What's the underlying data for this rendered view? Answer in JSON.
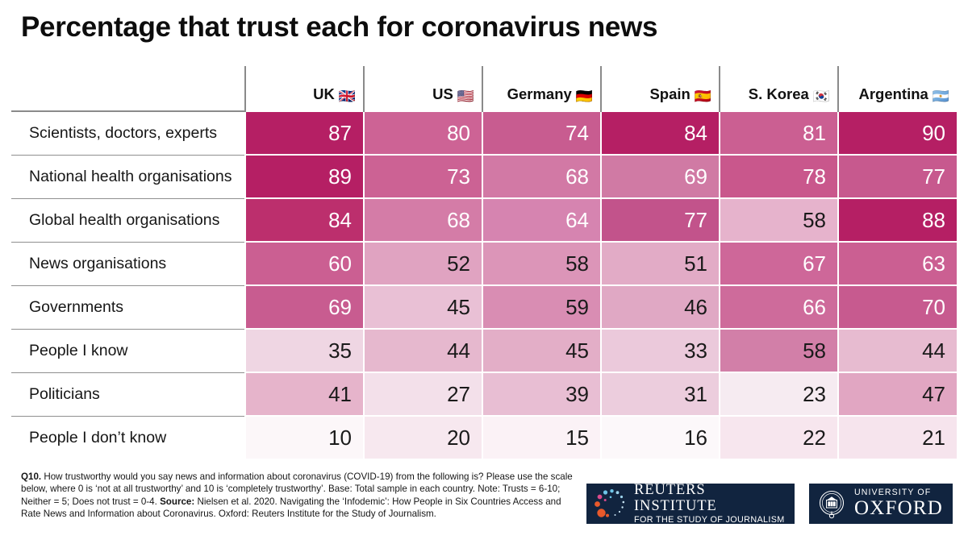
{
  "title": "Percentage that trust each for coronavirus news",
  "table": {
    "corner_label": "",
    "columns": [
      {
        "name": "UK",
        "flag": "🇬🇧"
      },
      {
        "name": "US",
        "flag": "🇺🇸"
      },
      {
        "name": "Germany",
        "flag": "🇩🇪"
      },
      {
        "name": "Spain",
        "flag": "🇪🇸"
      },
      {
        "name": "S. Korea",
        "flag": "🇰🇷"
      },
      {
        "name": "Argentina",
        "flag": "🇦🇷"
      }
    ],
    "rows": [
      {
        "label": "Scientists, doctors, experts"
      },
      {
        "label": "National health organisations"
      },
      {
        "label": "Global health organisations"
      },
      {
        "label": "News organisations"
      },
      {
        "label": "Governments"
      },
      {
        "label": "People I know"
      },
      {
        "label": "Politicians"
      },
      {
        "label": "People I don’t know"
      }
    ]
  },
  "chart_data": {
    "type": "heatmap",
    "title": "Percentage that trust each for coronavirus news",
    "xlabel": "",
    "ylabel": "",
    "unit": "percent",
    "grid": false,
    "legend": "none",
    "colorscale": {
      "low": "#FBF2F6",
      "high": "#B51F64",
      "normalisation": "per-column"
    },
    "value_range": [
      10,
      90
    ],
    "categories": [
      "UK",
      "US",
      "Germany",
      "Spain",
      "S. Korea",
      "Argentina"
    ],
    "rows": [
      "Scientists, doctors, experts",
      "National health organisations",
      "Global health organisations",
      "News organisations",
      "Governments",
      "People I know",
      "Politicians",
      "People I don’t know"
    ],
    "values": [
      [
        87,
        80,
        74,
        84,
        81,
        90
      ],
      [
        89,
        73,
        68,
        69,
        78,
        77
      ],
      [
        84,
        68,
        64,
        77,
        58,
        88
      ],
      [
        60,
        52,
        58,
        51,
        67,
        63
      ],
      [
        69,
        45,
        59,
        46,
        66,
        70
      ],
      [
        35,
        44,
        45,
        33,
        58,
        44
      ],
      [
        41,
        27,
        39,
        31,
        23,
        47
      ],
      [
        10,
        20,
        15,
        16,
        22,
        21
      ]
    ],
    "cell_colors": [
      [
        "#B51F64",
        "#CD6395",
        "#C85C90",
        "#B51F64",
        "#CB5F92",
        "#B51F64"
      ],
      [
        "#B51F64",
        "#CC6294",
        "#D279A5",
        "#D07AA4",
        "#C9578C",
        "#C7598E"
      ],
      [
        "#BC2F6D",
        "#D47CA7",
        "#D684B0",
        "#C2538B",
        "#E6B3CC",
        "#B51F64"
      ],
      [
        "#CB5F92",
        "#E0A3C1",
        "#DC95B8",
        "#E2ABC6",
        "#CE6799",
        "#CB5F92"
      ],
      [
        "#C85C90",
        "#E9C0D5",
        "#D98DB3",
        "#E0A8C4",
        "#CE6B9B",
        "#C75A8F"
      ],
      [
        "#EFD6E3",
        "#E6B8CE",
        "#E3AEC7",
        "#EBC9DB",
        "#D27FA8",
        "#E7BBD0"
      ],
      [
        "#E6B4CB",
        "#F3E0EA",
        "#E8BED3",
        "#ECCDDD",
        "#F6EBF1",
        "#E1A6C2"
      ],
      [
        "#FCF7F9",
        "#F7E8EF",
        "#FBF2F6",
        "#FCF8FA",
        "#F7E6EE",
        "#F6E4ED"
      ]
    ],
    "text_colors": [
      [
        "#ffffff",
        "#ffffff",
        "#ffffff",
        "#ffffff",
        "#ffffff",
        "#ffffff"
      ],
      [
        "#ffffff",
        "#ffffff",
        "#ffffff",
        "#ffffff",
        "#ffffff",
        "#ffffff"
      ],
      [
        "#ffffff",
        "#ffffff",
        "#ffffff",
        "#ffffff",
        "#1a1a1a",
        "#ffffff"
      ],
      [
        "#ffffff",
        "#1a1a1a",
        "#1a1a1a",
        "#1a1a1a",
        "#ffffff",
        "#ffffff"
      ],
      [
        "#ffffff",
        "#1a1a1a",
        "#1a1a1a",
        "#1a1a1a",
        "#ffffff",
        "#ffffff"
      ],
      [
        "#1a1a1a",
        "#1a1a1a",
        "#1a1a1a",
        "#1a1a1a",
        "#1a1a1a",
        "#1a1a1a"
      ],
      [
        "#1a1a1a",
        "#1a1a1a",
        "#1a1a1a",
        "#1a1a1a",
        "#1a1a1a",
        "#1a1a1a"
      ],
      [
        "#1a1a1a",
        "#1a1a1a",
        "#1a1a1a",
        "#1a1a1a",
        "#1a1a1a",
        "#1a1a1a"
      ]
    ]
  },
  "footnote": {
    "q_label": "Q10.",
    "body_1": " How trustworthy would you say news and information about coronavirus (COVID-19) from the following is? Please use the scale below, where 0 is ‘not at all trustworthy’ and 10 is ‘completely trustworthy’. Base: Total sample in each country. Note: Trusts = 6-10; Neither = 5; Does not trust = 0-4. ",
    "source_label": "Source:",
    "body_2": " Nielsen et al. 2020. Navigating the ‘Infodemic’: How People in Six Countries Access and Rate News and Information about Coronavirus. Oxford: Reuters Institute for the Study of Journalism."
  },
  "logos": {
    "reuters": {
      "line1": "REUTERS INSTITUTE",
      "line2": "FOR THE STUDY OF JOURNALISM"
    },
    "oxford": {
      "line1": "UNIVERSITY OF",
      "line2": "OXFORD"
    }
  }
}
